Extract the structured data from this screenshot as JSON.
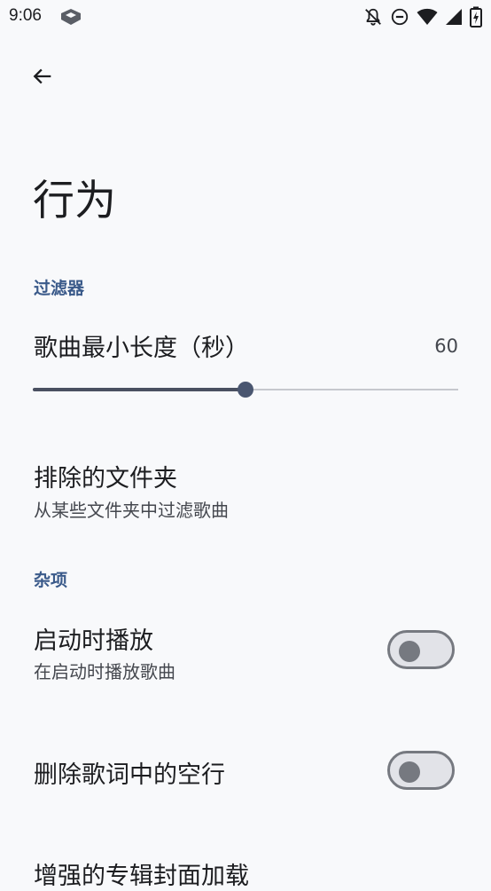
{
  "status_bar": {
    "time": "9:06",
    "icons": [
      "app-notification-icon",
      "notifications-off-icon",
      "do-not-disturb-icon",
      "wifi-icon",
      "cell-signal-icon",
      "battery-icon"
    ]
  },
  "toolbar": {
    "back_icon": "arrow-back-icon"
  },
  "page": {
    "title": "行为"
  },
  "sections": {
    "filters": {
      "header": "过滤器",
      "min_length": {
        "title": "歌曲最小长度（秒）",
        "value": "60",
        "fraction": 0.5
      },
      "excluded_folders": {
        "title": "排除的文件夹",
        "summary": "从某些文件夹中过滤歌曲"
      }
    },
    "misc": {
      "header": "杂项",
      "play_on_start": {
        "title": "启动时播放",
        "summary": "在启动时播放歌曲",
        "checked": false
      },
      "remove_empty_lyric_lines": {
        "title": "删除歌词中的空行",
        "checked": false
      },
      "enhanced_album_art": {
        "title": "增强的专辑封面加载"
      }
    }
  },
  "colors": {
    "accent": "#3a5a8a",
    "background": "#f8f9fb",
    "text_primary": "#1c1d20",
    "text_secondary": "#44474e",
    "switch_outline": "#767980"
  }
}
